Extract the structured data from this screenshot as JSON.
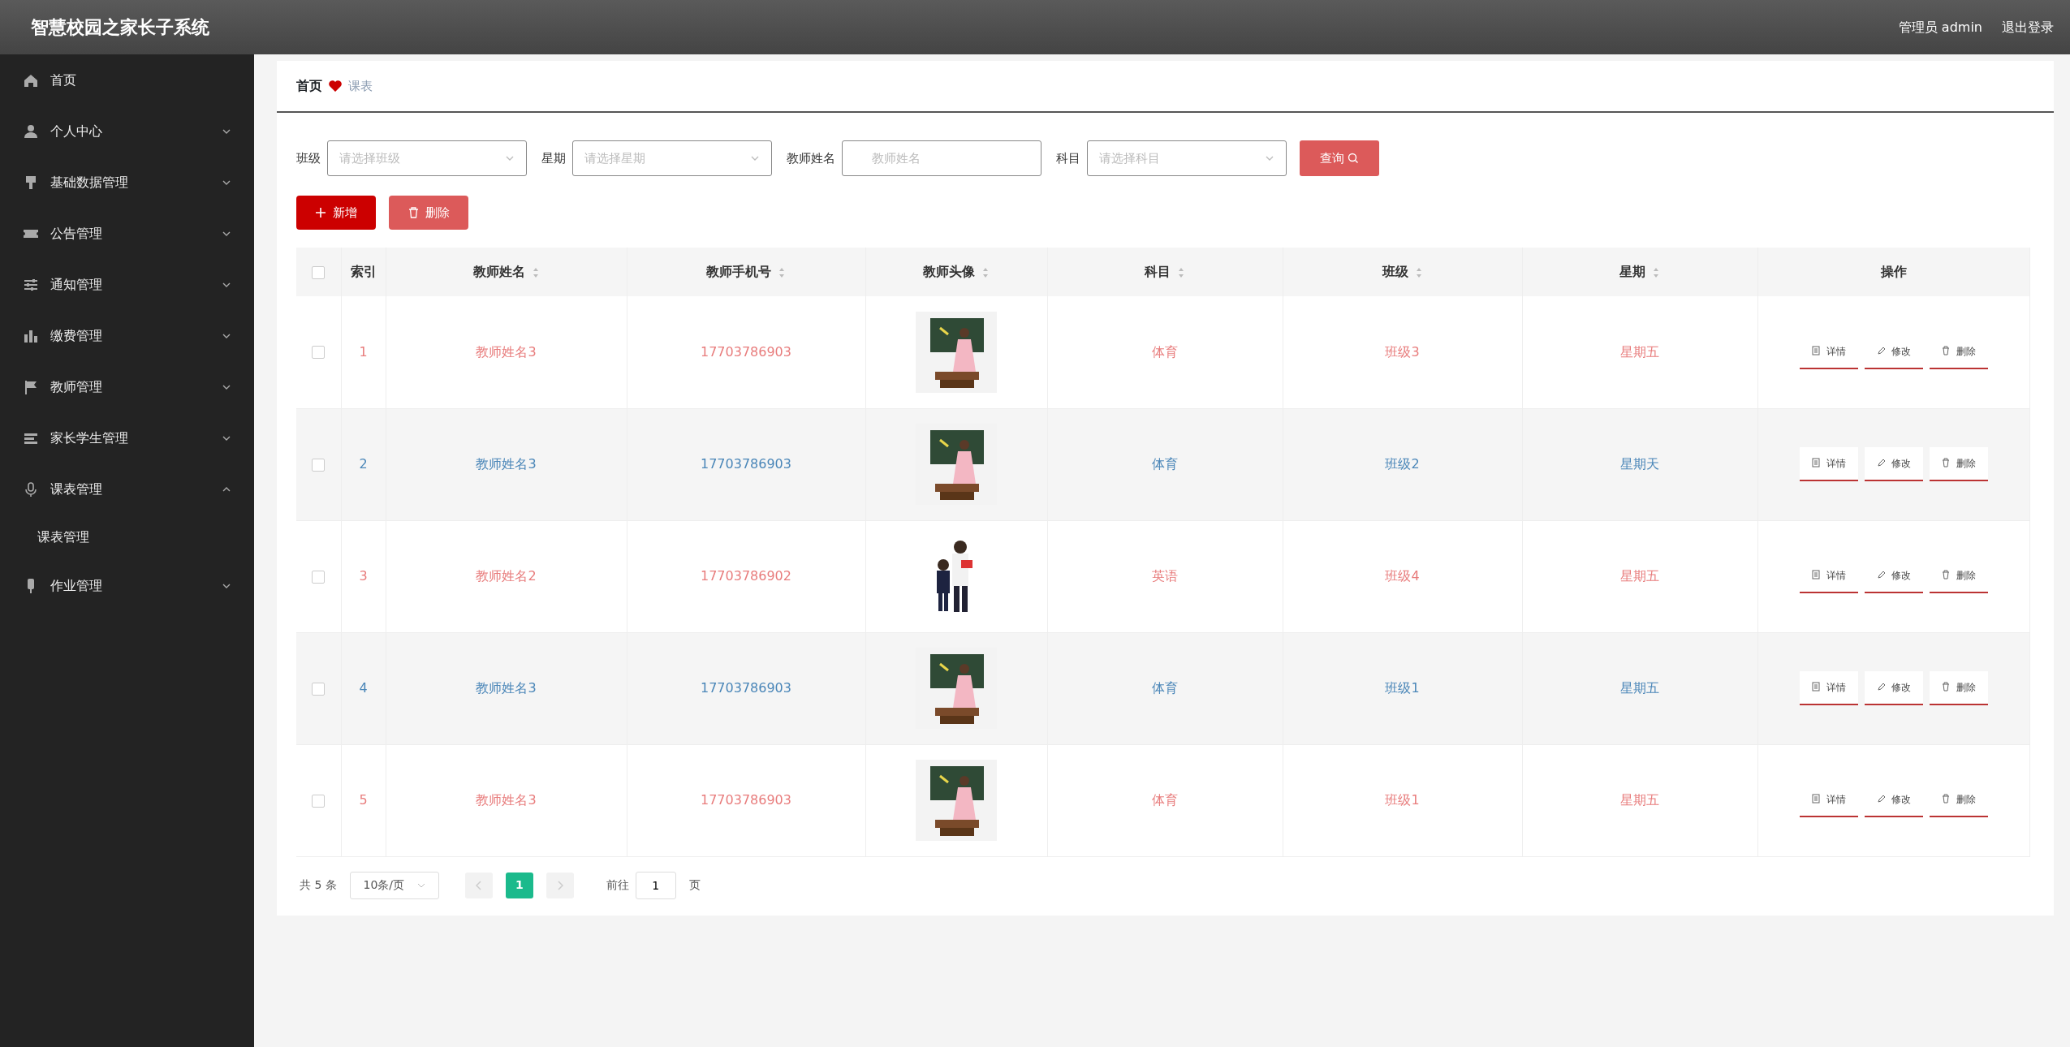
{
  "header": {
    "title": "智慧校园之家长子系统",
    "user": "管理员 admin",
    "logout": "退出登录"
  },
  "sidebar": {
    "items": [
      {
        "label": "首页",
        "kind": "link"
      },
      {
        "label": "个人中心",
        "kind": "menu",
        "expanded": false
      },
      {
        "label": "基础数据管理",
        "kind": "menu",
        "expanded": false
      },
      {
        "label": "公告管理",
        "kind": "menu",
        "expanded": false
      },
      {
        "label": "通知管理",
        "kind": "menu",
        "expanded": false
      },
      {
        "label": "缴费管理",
        "kind": "menu",
        "expanded": false
      },
      {
        "label": "教师管理",
        "kind": "menu",
        "expanded": false
      },
      {
        "label": "家长学生管理",
        "kind": "menu",
        "expanded": false
      },
      {
        "label": "课表管理",
        "kind": "menu",
        "expanded": true,
        "children": [
          {
            "label": "课表管理"
          }
        ]
      },
      {
        "label": "作业管理",
        "kind": "menu",
        "expanded": false
      }
    ]
  },
  "breadcrumb": {
    "home": "首页",
    "current": "课表"
  },
  "filters": [
    {
      "label": "班级",
      "kind": "select",
      "placeholder": "请选择班级"
    },
    {
      "label": "星期",
      "kind": "select",
      "placeholder": "请选择星期"
    },
    {
      "label": "教师姓名",
      "kind": "input",
      "placeholder": "教师姓名"
    },
    {
      "label": "科目",
      "kind": "select",
      "placeholder": "请选择科目"
    }
  ],
  "search_button": "查询",
  "toolbar": {
    "add": "新增",
    "delete": "删除"
  },
  "table": {
    "select_all": {
      "checked": false
    },
    "columns": [
      {
        "label": "索引",
        "sortable": false
      },
      {
        "label": "教师姓名",
        "sortable": true
      },
      {
        "label": "教师手机号",
        "sortable": true
      },
      {
        "label": "教师头像",
        "sortable": true
      },
      {
        "label": "科目",
        "sortable": true
      },
      {
        "label": "班级",
        "sortable": true
      },
      {
        "label": "星期",
        "sortable": true
      },
      {
        "label": "操作",
        "sortable": false
      }
    ],
    "rows": [
      {
        "checked": false,
        "index": "1",
        "name": "教师姓名3",
        "phone": "17703786903",
        "subject": "体育",
        "class": "班级3",
        "weekday": "星期五",
        "actions": [
          "详情",
          "修改",
          "删除"
        ]
      },
      {
        "checked": false,
        "index": "2",
        "name": "教师姓名3",
        "phone": "17703786903",
        "subject": "体育",
        "class": "班级2",
        "weekday": "星期天",
        "actions": [
          "详情",
          "修改",
          "删除"
        ]
      },
      {
        "checked": false,
        "index": "3",
        "name": "教师姓名2",
        "phone": "17703786902",
        "subject": "英语",
        "class": "班级4",
        "weekday": "星期五",
        "actions": [
          "详情",
          "修改",
          "删除"
        ]
      },
      {
        "checked": false,
        "index": "4",
        "name": "教师姓名3",
        "phone": "17703786903",
        "subject": "体育",
        "class": "班级1",
        "weekday": "星期五",
        "actions": [
          "详情",
          "修改",
          "删除"
        ]
      },
      {
        "checked": false,
        "index": "5",
        "name": "教师姓名3",
        "phone": "17703786903",
        "subject": "体育",
        "class": "班级1",
        "weekday": "星期五",
        "actions": [
          "详情",
          "修改",
          "删除"
        ]
      }
    ]
  },
  "pagination": {
    "total": "共 5 条",
    "page_size": "10条/页",
    "pages": [
      {
        "label": "1",
        "selected": true
      }
    ],
    "goto_label": "前往",
    "goto_value": "1",
    "goto_suffix": "页"
  }
}
